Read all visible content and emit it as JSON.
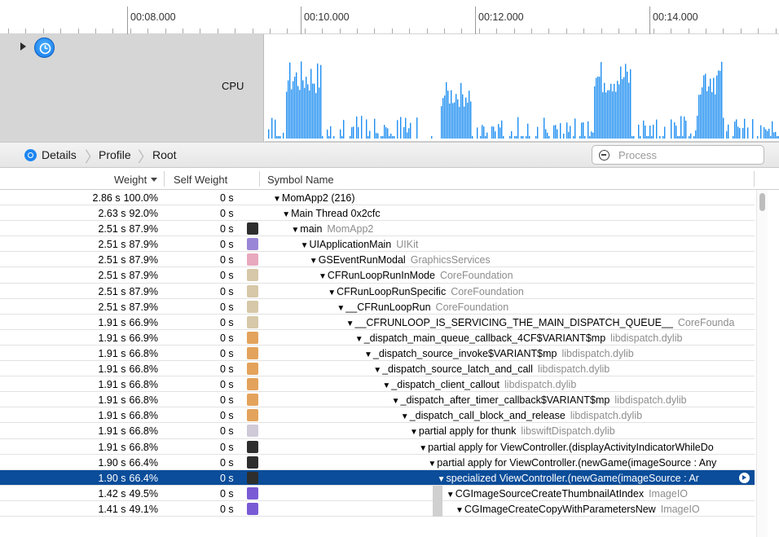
{
  "timeline": {
    "ticks": [
      "00:08.000",
      "00:10.000",
      "00:12.000",
      "00:14.000"
    ]
  },
  "track": {
    "label": "CPU",
    "icon": "cpu-gauge-icon",
    "accent": "#1f8ef1",
    "bursts": [
      {
        "start": 0.04,
        "end": 0.11,
        "level": 0.85
      },
      {
        "start": 0.34,
        "end": 0.4,
        "level": 0.62
      },
      {
        "start": 0.64,
        "end": 0.71,
        "level": 0.86
      },
      {
        "start": 0.84,
        "end": 0.89,
        "level": 0.86
      }
    ]
  },
  "navbar": {
    "breadcrumbs": [
      "Details",
      "Profile",
      "Root"
    ],
    "filter_placeholder": "Process"
  },
  "table": {
    "headers": {
      "weight": "Weight",
      "self": "Self Weight",
      "symbol": "Symbol Name"
    },
    "selected_row": 19,
    "rows": [
      {
        "weight": "2.86 s",
        "pct": "100.0%",
        "self": "0 s",
        "icon": "",
        "depth": 0,
        "name": "MomApp2 (216)",
        "lib": ""
      },
      {
        "weight": "2.63 s",
        "pct": "92.0%",
        "self": "0 s",
        "icon": "",
        "depth": 1,
        "name": "Main Thread  0x2cfc",
        "lib": ""
      },
      {
        "weight": "2.51 s",
        "pct": "87.9%",
        "self": "0 s",
        "icon": "person",
        "depth": 2,
        "name": "main",
        "lib": "MomApp2"
      },
      {
        "weight": "2.51 s",
        "pct": "87.9%",
        "self": "0 s",
        "icon": "purple",
        "depth": 3,
        "name": "UIApplicationMain",
        "lib": "UIKit"
      },
      {
        "weight": "2.51 s",
        "pct": "87.9%",
        "self": "0 s",
        "icon": "pink",
        "depth": 4,
        "name": "GSEventRunModal",
        "lib": "GraphicsServices"
      },
      {
        "weight": "2.51 s",
        "pct": "87.9%",
        "self": "0 s",
        "icon": "tan",
        "depth": 5,
        "name": "CFRunLoopRunInMode",
        "lib": "CoreFoundation"
      },
      {
        "weight": "2.51 s",
        "pct": "87.9%",
        "self": "0 s",
        "icon": "tan",
        "depth": 6,
        "name": "CFRunLoopRunSpecific",
        "lib": "CoreFoundation"
      },
      {
        "weight": "2.51 s",
        "pct": "87.9%",
        "self": "0 s",
        "icon": "tan",
        "depth": 7,
        "name": "__CFRunLoopRun",
        "lib": "CoreFoundation"
      },
      {
        "weight": "1.91 s",
        "pct": "66.9%",
        "self": "0 s",
        "icon": "tan",
        "depth": 8,
        "name": "__CFRUNLOOP_IS_SERVICING_THE_MAIN_DISPATCH_QUEUE__",
        "lib": "CoreFounda"
      },
      {
        "weight": "1.91 s",
        "pct": "66.9%",
        "self": "0 s",
        "icon": "orange",
        "depth": 9,
        "name": "_dispatch_main_queue_callback_4CF$VARIANT$mp",
        "lib": "libdispatch.dylib"
      },
      {
        "weight": "1.91 s",
        "pct": "66.8%",
        "self": "0 s",
        "icon": "orange",
        "depth": 10,
        "name": "_dispatch_source_invoke$VARIANT$mp",
        "lib": "libdispatch.dylib"
      },
      {
        "weight": "1.91 s",
        "pct": "66.8%",
        "self": "0 s",
        "icon": "orange",
        "depth": 11,
        "name": "_dispatch_source_latch_and_call",
        "lib": "libdispatch.dylib"
      },
      {
        "weight": "1.91 s",
        "pct": "66.8%",
        "self": "0 s",
        "icon": "orange",
        "depth": 12,
        "name": "_dispatch_client_callout",
        "lib": "libdispatch.dylib"
      },
      {
        "weight": "1.91 s",
        "pct": "66.8%",
        "self": "0 s",
        "icon": "orange",
        "depth": 13,
        "name": "_dispatch_after_timer_callback$VARIANT$mp",
        "lib": "libdispatch.dylib"
      },
      {
        "weight": "1.91 s",
        "pct": "66.8%",
        "self": "0 s",
        "icon": "orange",
        "depth": 14,
        "name": "_dispatch_call_block_and_release",
        "lib": "libdispatch.dylib"
      },
      {
        "weight": "1.91 s",
        "pct": "66.8%",
        "self": "0 s",
        "icon": "grid",
        "depth": 15,
        "name": "partial apply for thunk",
        "lib": "libswiftDispatch.dylib"
      },
      {
        "weight": "1.91 s",
        "pct": "66.8%",
        "self": "0 s",
        "icon": "person",
        "depth": 16,
        "name": "partial apply for ViewController.(displayActivityIndicatorWhileDo",
        "lib": ""
      },
      {
        "weight": "1.90 s",
        "pct": "66.4%",
        "self": "0 s",
        "icon": "person",
        "depth": 17,
        "name": "partial apply for ViewController.(newGame(imageSource : Any",
        "lib": ""
      },
      {
        "weight": "1.90 s",
        "pct": "66.4%",
        "self": "0 s",
        "icon": "person",
        "depth": 18,
        "name": "specialized ViewController.(newGame(imageSource : Ar",
        "lib": ""
      },
      {
        "weight": "1.42 s",
        "pct": "49.5%",
        "self": "0 s",
        "icon": "violet",
        "depth": 19,
        "name": "CGImageSourceCreateThumbnailAtIndex",
        "lib": "ImageIO"
      },
      {
        "weight": "1.41 s",
        "pct": "49.1%",
        "self": "0 s",
        "icon": "violet",
        "depth": 20,
        "name": "CGImageCreateCopyWithParametersNew",
        "lib": "ImageIO"
      }
    ]
  }
}
